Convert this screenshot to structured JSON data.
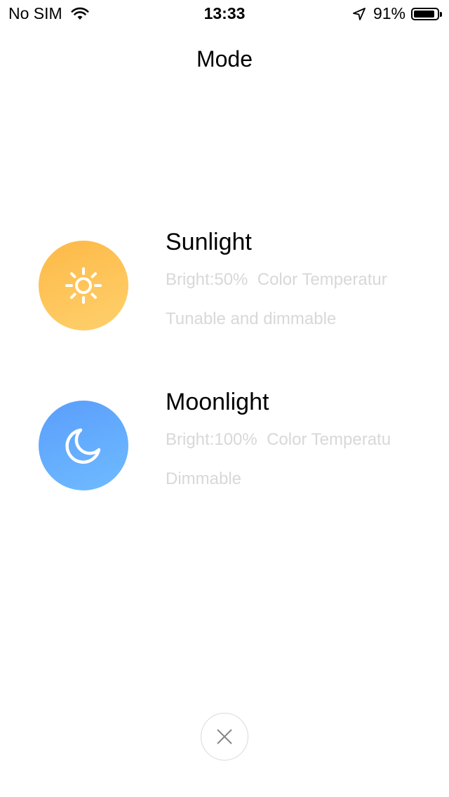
{
  "status_bar": {
    "carrier": "No SIM",
    "time": "13:33",
    "battery_percent": "91%",
    "battery_level": 0.91
  },
  "header": {
    "title": "Mode"
  },
  "modes": [
    {
      "name": "Sunlight",
      "detail": "Bright:50%  Color Temperatur",
      "description": "Tunable and dimmable",
      "icon": "sun-icon",
      "color": "#fdc059"
    },
    {
      "name": "Moonlight",
      "detail": "Bright:100%  Color Temperatu",
      "description": "Dimmable",
      "icon": "moon-icon",
      "color": "#62abfd"
    }
  ],
  "close_icon": "close-icon"
}
